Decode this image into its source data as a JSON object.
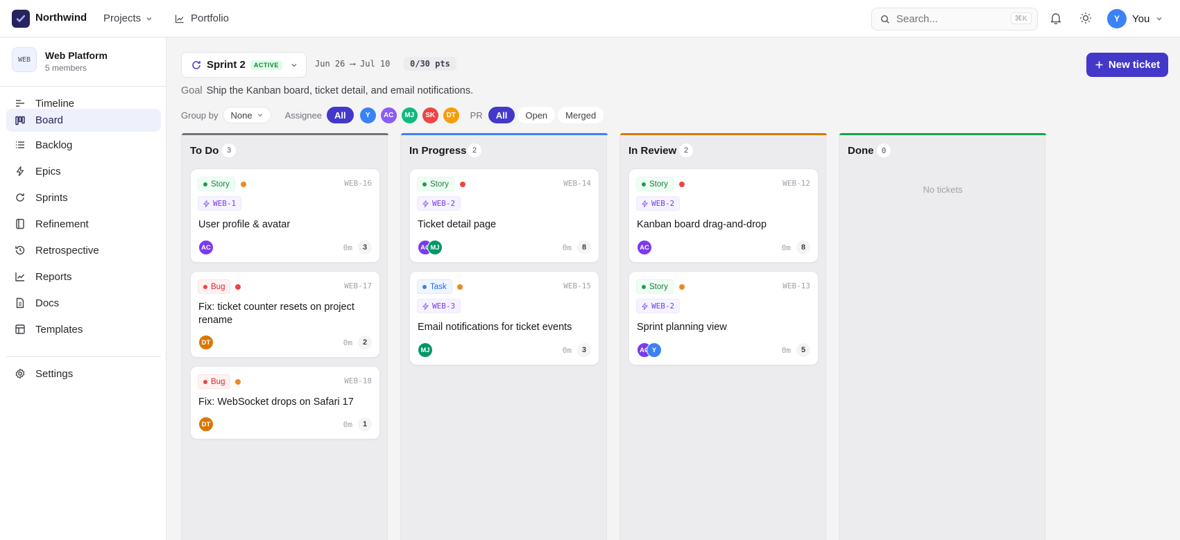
{
  "topbar": {
    "brand": "Northwind",
    "projects": "Projects",
    "portfolio": "Portfolio",
    "search_placeholder": "Search...",
    "search_kbd": "⌘K",
    "user_initial": "Y",
    "user_name": "You"
  },
  "sidebar": {
    "project_badge": "WEB",
    "project_name": "Web Platform",
    "project_members": "5 members",
    "items": [
      {
        "label": "Timeline",
        "icon": "timeline-icon"
      },
      {
        "label": "Board",
        "icon": "board-icon",
        "active": true
      },
      {
        "label": "Backlog",
        "icon": "list-icon"
      },
      {
        "label": "Epics",
        "icon": "lightning-icon"
      },
      {
        "label": "Sprints",
        "icon": "cycle-icon"
      },
      {
        "label": "Refinement",
        "icon": "book-icon"
      },
      {
        "label": "Retrospective",
        "icon": "history-icon"
      },
      {
        "label": "Reports",
        "icon": "chart-line-icon"
      },
      {
        "label": "Docs",
        "icon": "document-icon"
      },
      {
        "label": "Templates",
        "icon": "template-icon"
      }
    ],
    "settings": "Settings"
  },
  "sprint": {
    "name": "Sprint 2",
    "status": "ACTIVE",
    "dates": "Jun 26 ⟶ Jul 10",
    "points": "0/30 pts",
    "goal_label": "Goal",
    "goal_text": "Ship the Kanban board, ticket detail, and email notifications."
  },
  "actions": {
    "new_ticket": "New ticket"
  },
  "filters": {
    "group_by_label": "Group by",
    "group_by_value": "None",
    "assignee_label": "Assignee",
    "assignee_all": "All",
    "assignees": [
      {
        "initials": "Y",
        "color": "#3b82f6"
      },
      {
        "initials": "AC",
        "color": "#8b5cf6"
      },
      {
        "initials": "MJ",
        "color": "#10b981"
      },
      {
        "initials": "SK",
        "color": "#ef4444"
      },
      {
        "initials": "DT",
        "color": "#f59e0b"
      }
    ],
    "pr_label": "PR",
    "pr_options": [
      "All",
      "Open",
      "Merged"
    ]
  },
  "columns": [
    {
      "title": "To Do",
      "count": "3",
      "accent": "#71717a"
    },
    {
      "title": "In Progress",
      "count": "2",
      "accent": "#3b82f6"
    },
    {
      "title": "In Review",
      "count": "2",
      "accent": "#d97706"
    },
    {
      "title": "Done",
      "count": "0",
      "accent": "#16a34a",
      "empty_text": "No tickets"
    }
  ],
  "cards": {
    "c16": {
      "type": "Story",
      "key": "WEB-16",
      "epic": "WEB-1",
      "title": "User profile & avatar",
      "time": "0m",
      "points": "3",
      "assignees": [
        "AC"
      ]
    },
    "c17": {
      "type": "Bug",
      "key": "WEB-17",
      "title": "Fix: ticket counter resets on project rename",
      "time": "0m",
      "points": "2",
      "assignees": [
        "DT"
      ]
    },
    "c18": {
      "type": "Bug",
      "key": "WEB-18",
      "title": "Fix: WebSocket drops on Safari 17",
      "time": "0m",
      "points": "1",
      "assignees": [
        "DT"
      ]
    },
    "c14": {
      "type": "Story",
      "key": "WEB-14",
      "epic": "WEB-2",
      "title": "Ticket detail page",
      "time": "0m",
      "points": "8",
      "assignees": [
        "AC",
        "MJ"
      ]
    },
    "c15": {
      "type": "Task",
      "key": "WEB-15",
      "epic": "WEB-3",
      "title": "Email notifications for ticket events",
      "time": "0m",
      "points": "3",
      "assignees": [
        "MJ"
      ]
    },
    "c12": {
      "type": "Story",
      "key": "WEB-12",
      "epic": "WEB-2",
      "title": "Kanban board drag-and-drop",
      "time": "0m",
      "points": "8",
      "assignees": [
        "AC"
      ]
    },
    "c13": {
      "type": "Story",
      "key": "WEB-13",
      "epic": "WEB-2",
      "title": "Sprint planning view",
      "time": "0m",
      "points": "5",
      "assignees": [
        "AC",
        "Y"
      ]
    }
  },
  "colors": {
    "brand": "#4338ca",
    "story_tag": "#15803d",
    "bug_tag": "#dc2626",
    "task_tag": "#2563eb",
    "priority_high": "#ef4444",
    "priority_medium": "#ea8a26"
  }
}
